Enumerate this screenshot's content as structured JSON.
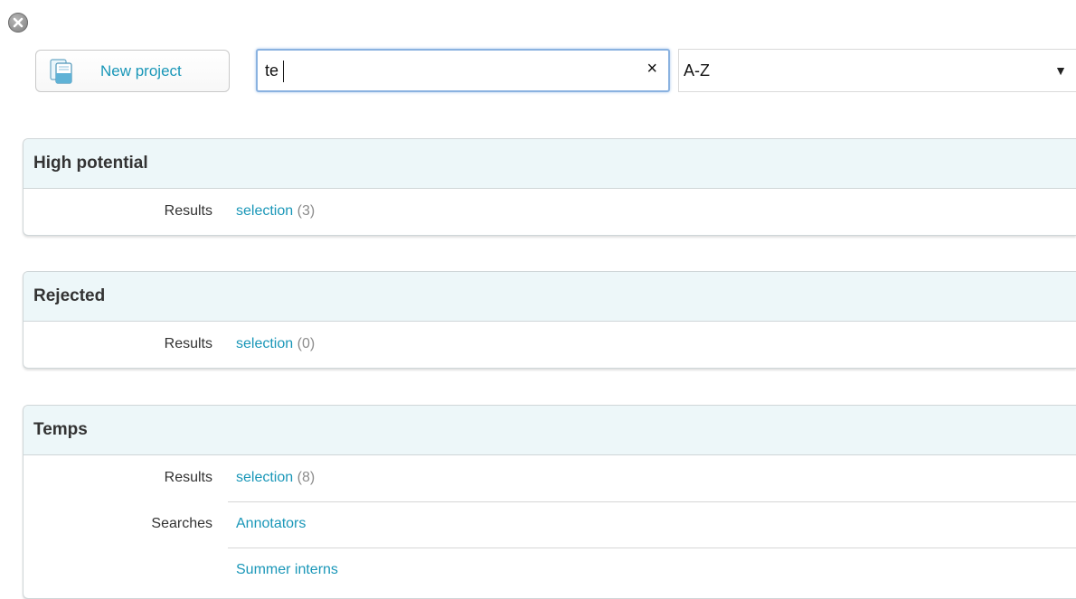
{
  "toolbar": {
    "new_project_label": "New project",
    "search_value": "te",
    "search_clear_glyph": "×",
    "sort_value": "A-Z",
    "sort_arrow_glyph": "▼"
  },
  "icons": {
    "close": "close-circle-icon",
    "new_project": "document-icon",
    "clear": "clear-x-icon",
    "dropdown": "dropdown-arrow-icon"
  },
  "colors": {
    "link": "#1a97b8",
    "panel_header_bg": "#edf7f9",
    "count": "#8c8c8c"
  },
  "panels": [
    {
      "title": "High potential",
      "rows": [
        {
          "label": "Results",
          "link": "selection",
          "count": "(3)"
        }
      ]
    },
    {
      "title": "Rejected",
      "rows": [
        {
          "label": "Results",
          "link": "selection",
          "count": "(0)"
        }
      ]
    },
    {
      "title": "Temps",
      "rows": [
        {
          "label": "Results",
          "link": "selection",
          "count": "(8)"
        },
        {
          "label": "Searches",
          "link": "Annotators"
        },
        {
          "link": "Summer interns"
        }
      ]
    }
  ]
}
